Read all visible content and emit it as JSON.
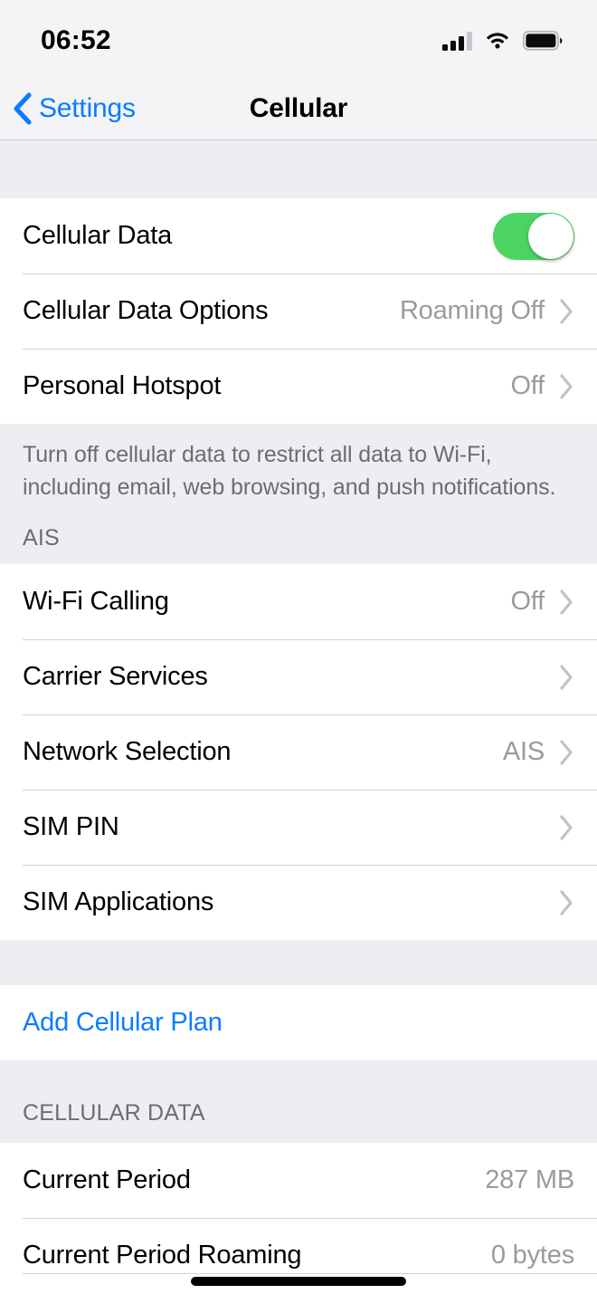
{
  "status_bar": {
    "time": "06:52",
    "signal_icon": "cellular-signal-icon",
    "signal_bars_filled": 3,
    "signal_bars_total": 4,
    "wifi_icon": "wifi-icon",
    "battery_icon": "battery-icon",
    "battery_level_percent": 92
  },
  "nav": {
    "back_label": "Settings",
    "back_icon": "chevron-left-icon",
    "title": "Cellular"
  },
  "colors": {
    "accent_blue": "#0a7cff",
    "toggle_on_green": "#4cd463",
    "group_background": "#ffffff",
    "page_background": "#efedf1",
    "secondary_text": "#9a9a9f"
  },
  "sections": [
    {
      "id": "cellular-data-group",
      "header": "",
      "rows": [
        {
          "label": "Cellular Data",
          "value": "",
          "control": "toggle",
          "toggle_on": true
        },
        {
          "label": "Cellular Data Options",
          "value": "Roaming Off",
          "control": "disclosure"
        },
        {
          "label": "Personal Hotspot",
          "value": "Off",
          "control": "disclosure"
        }
      ],
      "footer": "Turn off cellular data to restrict all data to Wi-Fi, including email, web browsing, and push notifications."
    },
    {
      "id": "carrier-group",
      "header": "AIS",
      "rows": [
        {
          "label": "Wi-Fi Calling",
          "value": "Off",
          "control": "disclosure"
        },
        {
          "label": "Carrier Services",
          "value": "",
          "control": "disclosure"
        },
        {
          "label": "Network Selection",
          "value": "AIS",
          "control": "disclosure"
        },
        {
          "label": "SIM PIN",
          "value": "",
          "control": "disclosure"
        },
        {
          "label": "SIM Applications",
          "value": "",
          "control": "disclosure"
        }
      ],
      "footer": ""
    },
    {
      "id": "add-plan-group",
      "header": "",
      "rows": [
        {
          "label": "Add Cellular Plan",
          "value": "",
          "control": "link"
        }
      ],
      "footer": ""
    },
    {
      "id": "cellular-data-usage-group",
      "header": "CELLULAR DATA",
      "rows": [
        {
          "label": "Current Period",
          "value": "287 MB",
          "control": "none"
        },
        {
          "label": "Current Period Roaming",
          "value": "0 bytes",
          "control": "none"
        }
      ],
      "footer": ""
    }
  ],
  "home_indicator": "home-indicator-bar"
}
